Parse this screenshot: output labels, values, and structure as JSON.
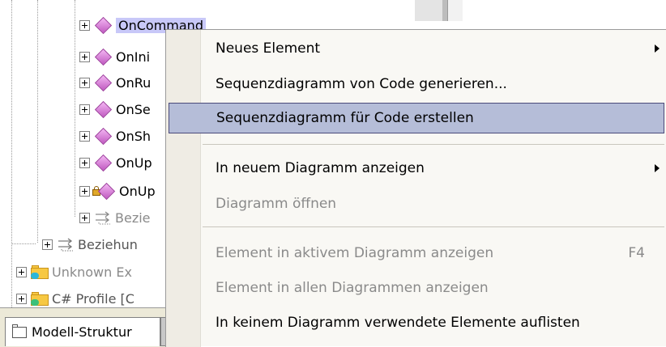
{
  "tree": {
    "nodes": [
      {
        "label": "OnCommand",
        "kind": "operation",
        "selected": true
      },
      {
        "label": "OnIni",
        "kind": "operation"
      },
      {
        "label": "OnRu",
        "kind": "operation"
      },
      {
        "label": "OnSe",
        "kind": "operation"
      },
      {
        "label": "OnSh",
        "kind": "operation"
      },
      {
        "label": "OnUp",
        "kind": "operation"
      },
      {
        "label": "OnUp",
        "kind": "operation-locked"
      },
      {
        "label": "Bezie",
        "kind": "relations",
        "dimmed": true
      },
      {
        "label": "Beziehun",
        "kind": "relations"
      },
      {
        "label": "Unknown Ex",
        "kind": "folder",
        "dimmed": true
      },
      {
        "label": "C# Profile [C",
        "kind": "folder"
      }
    ]
  },
  "tabs": {
    "modell_struktur": "Modell-Struktur"
  },
  "context_menu": {
    "items": [
      {
        "label": "Neues Element",
        "submenu": true
      },
      {
        "label": "Sequenzdiagramm von Code generieren..."
      },
      {
        "label": "Sequenzdiagramm für Code erstellen",
        "highlighted": true
      },
      {
        "label": "In neuem Diagramm anzeigen",
        "submenu": true
      },
      {
        "label": "Diagramm öffnen",
        "disabled": true
      },
      {
        "label": "Element in aktivem Diagramm anzeigen",
        "disabled": true,
        "shortcut": "F4"
      },
      {
        "label": "Element in allen Diagrammen anzeigen",
        "disabled": true
      },
      {
        "label": "In keinem Diagramm verwendete Elemente auflisten"
      }
    ]
  },
  "colors": {
    "menu_highlight": "#b5bdd8",
    "tree_selection": "#c8c8f8",
    "operation_icon": "#c05ac0",
    "folder": "#f7c842"
  }
}
